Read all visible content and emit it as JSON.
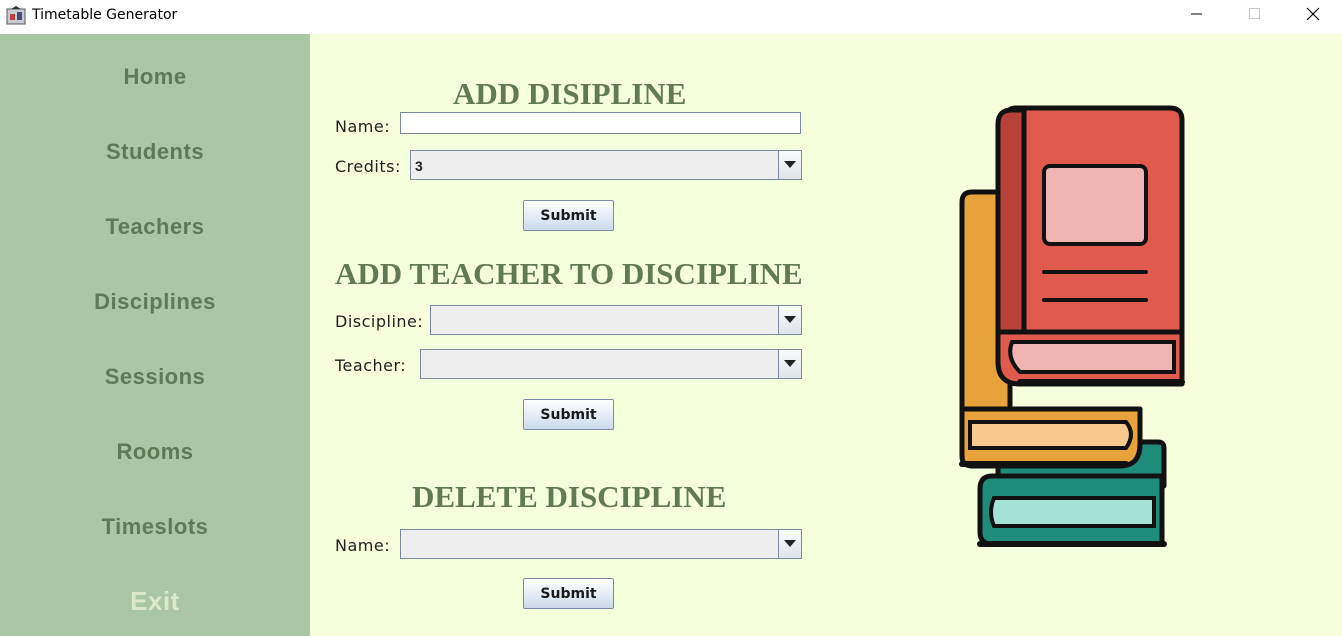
{
  "window": {
    "title": "Timetable Generator",
    "app_icon": "java-app-icon",
    "controls": [
      "minimize-icon",
      "maximize-icon",
      "close-icon"
    ]
  },
  "sidebar": {
    "items": [
      {
        "label": "Home"
      },
      {
        "label": "Students"
      },
      {
        "label": "Teachers"
      },
      {
        "label": "Disciplines"
      },
      {
        "label": "Sessions"
      },
      {
        "label": "Rooms"
      },
      {
        "label": "Timeslots"
      },
      {
        "label": "Exit"
      }
    ]
  },
  "add_discipline": {
    "heading": "ADD DISIPLINE",
    "name_label": "Name:",
    "name_value": "",
    "credits_label": "Credits:",
    "credits_value": "3",
    "submit_label": "Submit"
  },
  "add_teacher": {
    "heading": "ADD TEACHER TO DISCIPLINE",
    "discipline_label": "Discipline:",
    "discipline_value": "",
    "teacher_label": "Teacher:",
    "teacher_value": "",
    "submit_label": "Submit"
  },
  "delete_discipline": {
    "heading": "DELETE DISCIPLINE",
    "name_label": "Name:",
    "name_value": "",
    "submit_label": "Submit"
  },
  "illustration": {
    "icon": "books-stack-icon"
  },
  "colors": {
    "sidebar_bg": "#a9c6a5",
    "sidebar_text": "#5c7a54",
    "exit_text": "#dce9c7",
    "main_bg": "#f6ffdc",
    "heading_text": "#5f7a55"
  }
}
